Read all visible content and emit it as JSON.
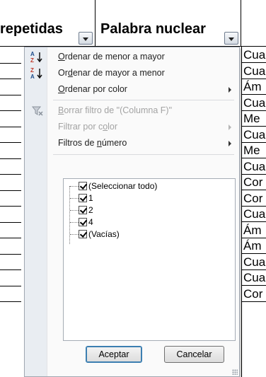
{
  "sheet": {
    "header_col1": "repetidas",
    "header_col2": "Palabra nuclear",
    "right_cells": [
      "Cua",
      "Cua",
      "Ám",
      "Cua",
      "Me",
      "Cua",
      "Me",
      "Cua",
      "Cor",
      "Cor",
      "Cua",
      "Ám",
      "Ám",
      "Cua",
      "Cua",
      "Cor"
    ]
  },
  "menu": {
    "sort_asc": {
      "pre": "",
      "key": "O",
      "post": "rdenar de menor a mayor",
      "icon": "sort-ascending-icon"
    },
    "sort_desc": {
      "pre": "Or",
      "key": "d",
      "post": "enar de mayor a menor",
      "icon": "sort-descending-icon"
    },
    "sort_color": {
      "pre": "",
      "key": "O",
      "post": "rdenar por color"
    },
    "clear_filter": {
      "pre": "",
      "key": "B",
      "post": "orrar filtro de \"(Columna F)\"",
      "icon": "clear-filter-icon"
    },
    "filter_color": {
      "pre": "Filtrar por c",
      "key": "o",
      "post": "lor"
    },
    "number_filters": {
      "pre": "Filtros de ",
      "key": "n",
      "post": "úmero"
    }
  },
  "list": {
    "items": [
      "(Seleccionar todo)",
      "1",
      "2",
      "4",
      "(Vacías)"
    ]
  },
  "buttons": {
    "ok": "Aceptar",
    "cancel": "Cancelar"
  }
}
